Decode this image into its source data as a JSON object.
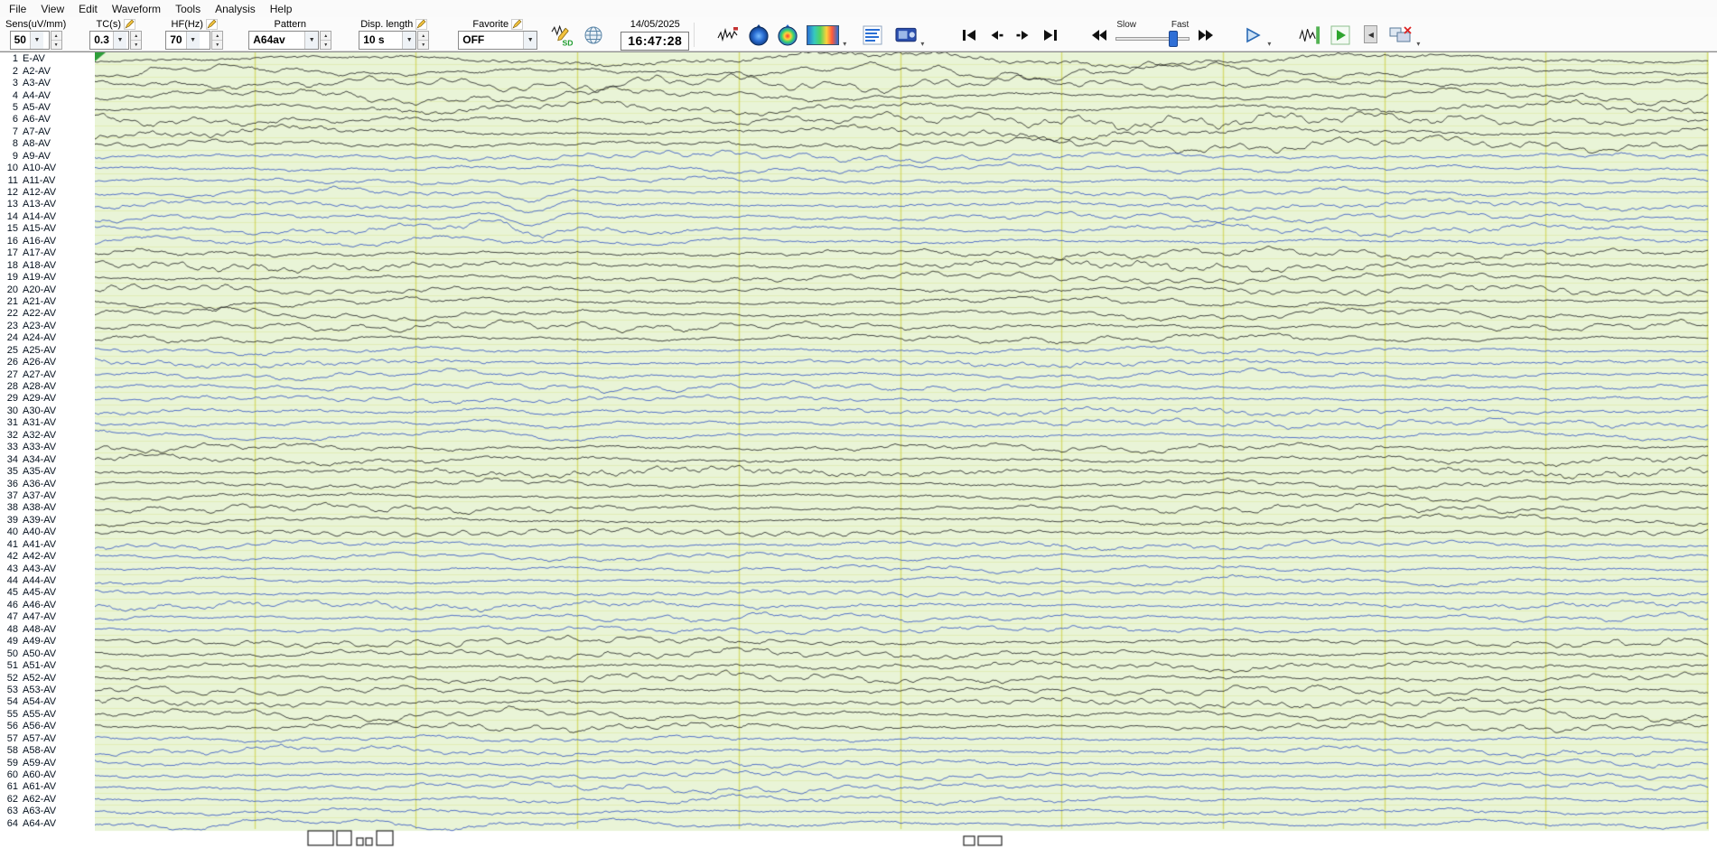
{
  "menu": {
    "items": [
      "File",
      "View",
      "Edit",
      "Waveform",
      "Tools",
      "Analysis",
      "Help"
    ]
  },
  "toolbar": {
    "fields": [
      {
        "label": "Sens(uV/mm)",
        "value": "50"
      },
      {
        "label": "TC(s)",
        "value": "0.3"
      },
      {
        "label": "HF(Hz)",
        "value": "70"
      },
      {
        "label": "Pattern",
        "value": "A64av"
      },
      {
        "label": "Disp. length",
        "value": "10 s"
      },
      {
        "label": "Favorite",
        "value": "OFF"
      }
    ],
    "date": "14/05/2025",
    "time": "16:47:28",
    "sd_label": "SD",
    "slider": {
      "slow": "Slow",
      "fast": "Fast"
    }
  },
  "channels": [
    "E-AV",
    "A2-AV",
    "A3-AV",
    "A4-AV",
    "A5-AV",
    "A6-AV",
    "A7-AV",
    "A8-AV",
    "A9-AV",
    "A10-AV",
    "A11-AV",
    "A12-AV",
    "A13-AV",
    "A14-AV",
    "A15-AV",
    "A16-AV",
    "A17-AV",
    "A18-AV",
    "A19-AV",
    "A20-AV",
    "A21-AV",
    "A22-AV",
    "A23-AV",
    "A24-AV",
    "A25-AV",
    "A26-AV",
    "A27-AV",
    "A28-AV",
    "A29-AV",
    "A30-AV",
    "A31-AV",
    "A32-AV",
    "A33-AV",
    "A34-AV",
    "A35-AV",
    "A36-AV",
    "A37-AV",
    "A38-AV",
    "A39-AV",
    "A40-AV",
    "A41-AV",
    "A42-AV",
    "A43-AV",
    "A44-AV",
    "A45-AV",
    "A46-AV",
    "A47-AV",
    "A48-AV",
    "A49-AV",
    "A50-AV",
    "A51-AV",
    "A52-AV",
    "A53-AV",
    "A54-AV",
    "A55-AV",
    "A56-AV",
    "A57-AV",
    "A58-AV",
    "A59-AV",
    "A60-AV",
    "A61-AV",
    "A62-AV",
    "A63-AV",
    "A64-AV"
  ],
  "waveform": {
    "seconds_displayed": 10,
    "background": "#e9f4d7",
    "grid_color": "#c9c931",
    "trace_colors": {
      "dark": "#1b1b1b",
      "blue": "#2c4ec2"
    },
    "group_size": 8
  }
}
